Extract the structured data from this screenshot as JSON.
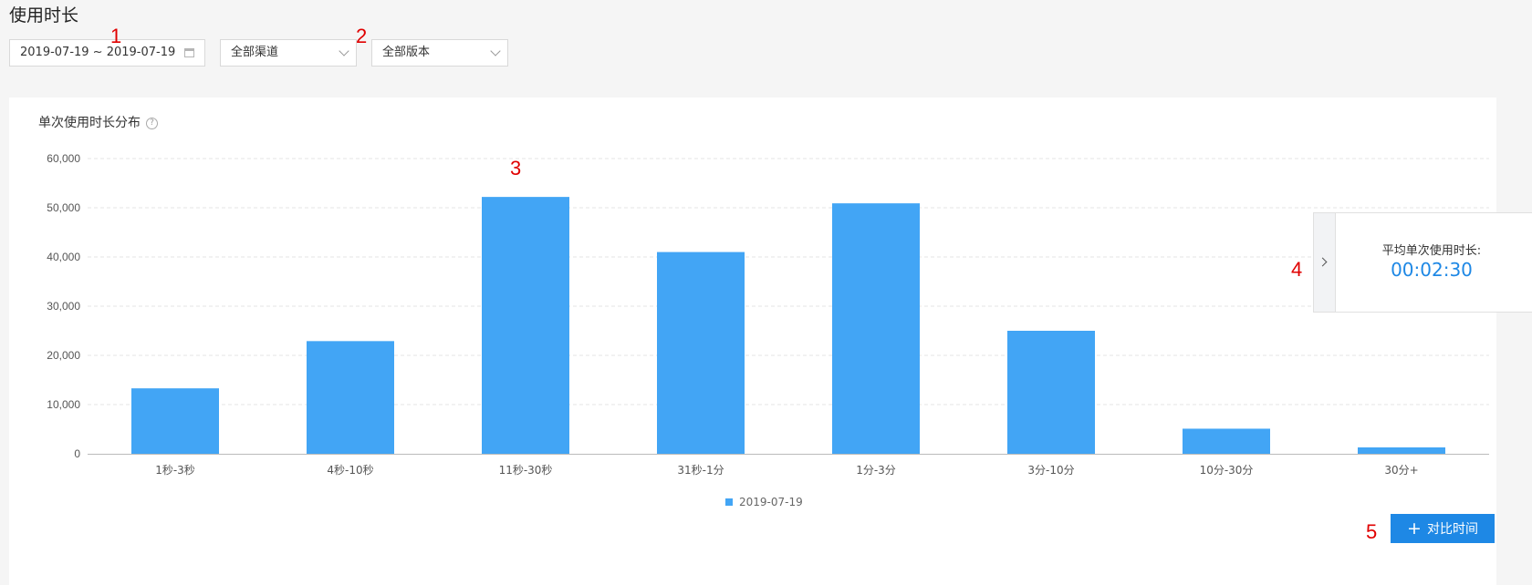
{
  "page": {
    "title": "使用时长"
  },
  "filters": {
    "date_range": "2019-07-19 ~ 2019-07-19",
    "channel": "全部渠道",
    "version": "全部版本"
  },
  "markers": [
    "1",
    "2",
    "3",
    "4",
    "5"
  ],
  "chart_section": {
    "title": "单次使用时长分布",
    "help_icon": "?"
  },
  "side_panel": {
    "label": "平均单次使用时长:",
    "value": "00:02:30"
  },
  "compare_button": {
    "plus": "+",
    "label": "对比时间"
  },
  "colors": {
    "bar": "#42a5f5",
    "accent": "#1e88e5",
    "marker": "#e00000"
  },
  "chart_data": {
    "type": "bar",
    "title": "单次使用时长分布",
    "categories": [
      "1秒-3秒",
      "4秒-10秒",
      "11秒-30秒",
      "31秒-1分",
      "1分-3分",
      "3分-10分",
      "10分-30分",
      "30分+"
    ],
    "series": [
      {
        "name": "2019-07-19",
        "values": [
          13300,
          22900,
          52200,
          41000,
          50900,
          25000,
          5100,
          1300
        ]
      }
    ],
    "ylim": [
      0,
      60000
    ],
    "yticks": [
      "0",
      "10,000",
      "20,000",
      "30,000",
      "40,000",
      "50,000",
      "60,000"
    ],
    "grid": true,
    "legend": "bottom-center"
  }
}
